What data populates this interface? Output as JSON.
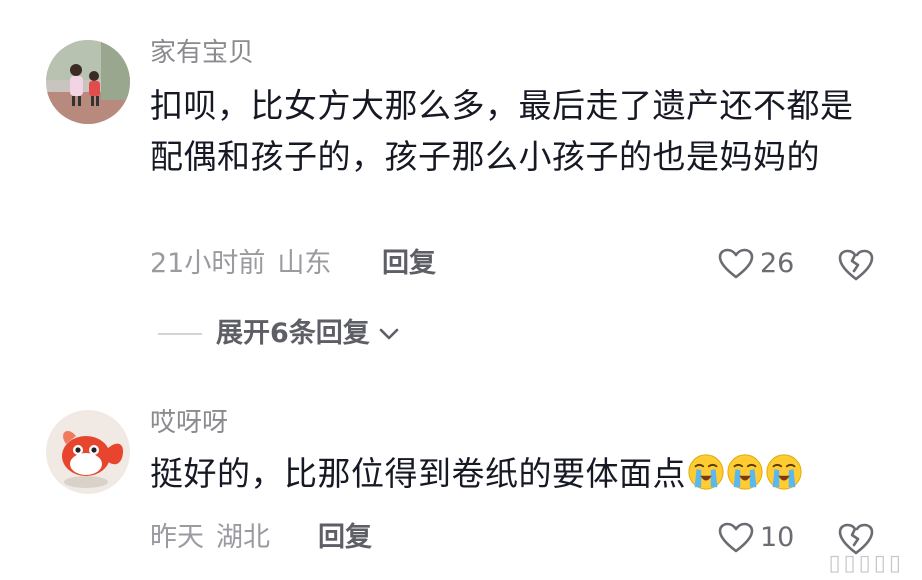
{
  "comments": [
    {
      "username": "家有宝贝",
      "text": "扣呗，比女方大那么多，最后走了遗产还不都是配偶和孩子的，孩子那么小孩子的也是妈妈的",
      "time": "21小时前",
      "location": "山东",
      "reply_label": "回复",
      "likes": "26",
      "avatar_icon": "photo-two-children-avatar"
    },
    {
      "username": "哎呀呀",
      "text": "挺好的，比那位得到卷纸的要体面点",
      "emoji": [
        "loudly-crying-face",
        "loudly-crying-face",
        "loudly-crying-face"
      ],
      "time": "昨天",
      "location": "湖北",
      "reply_label": "回复",
      "likes": "10",
      "avatar_icon": "red-goldfish-avatar"
    }
  ],
  "expand_replies": {
    "label": "展开6条回复",
    "icon": "chevron-down-icon"
  },
  "watermark": "▯▯▯▯▯",
  "colors": {
    "text_primary": "#161823",
    "text_secondary": "#9a9aa0",
    "username": "#8a8a8f",
    "reply": "#5e5e66"
  }
}
